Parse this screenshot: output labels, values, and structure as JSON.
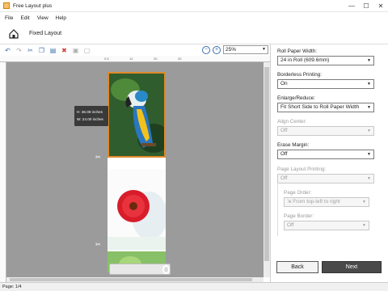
{
  "window": {
    "title": "Free Layout plus",
    "minimize": "—",
    "maximize": "☐",
    "close": "✕"
  },
  "menu": [
    "File",
    "Edit",
    "View",
    "Help"
  ],
  "nav": {
    "layout_name": "Fixed Layout"
  },
  "toolbar": {
    "zoom_value": "25%"
  },
  "ruler": {
    "ticks_h": [
      "0.5",
      "12",
      "20",
      "32"
    ]
  },
  "canvas": {
    "size_tip": {
      "height": "H: 36.09 inches",
      "width": "W: 24.00 inches"
    }
  },
  "settings": {
    "roll_paper_width": {
      "label": "Roll Paper Width:",
      "value": "24 in Roll (609.6mm)"
    },
    "borderless": {
      "label": "Borderless Printing:",
      "value": "On"
    },
    "enlarge_reduce": {
      "label": "Enlarge/Reduce:",
      "value": "Fit Short Side to Roll Paper Width"
    },
    "align_center": {
      "label": "Align Center:",
      "value": "Off"
    },
    "erase_margin": {
      "label": "Erase Margin:",
      "value": "Off"
    },
    "page_layout": {
      "label": "Page Layout Printing:",
      "value": "Off"
    },
    "page_order": {
      "label": "Page Order:",
      "value": "From top-left to right"
    },
    "page_border": {
      "label": "Page Border:",
      "value": "Off"
    }
  },
  "buttons": {
    "back": "Back",
    "next": "Next"
  },
  "status": {
    "page": "Page: 1/4"
  },
  "colors": {
    "selection": "#e08a2a",
    "canvas_bg": "#9b9b9b",
    "next_btn": "#4a4a4a"
  }
}
